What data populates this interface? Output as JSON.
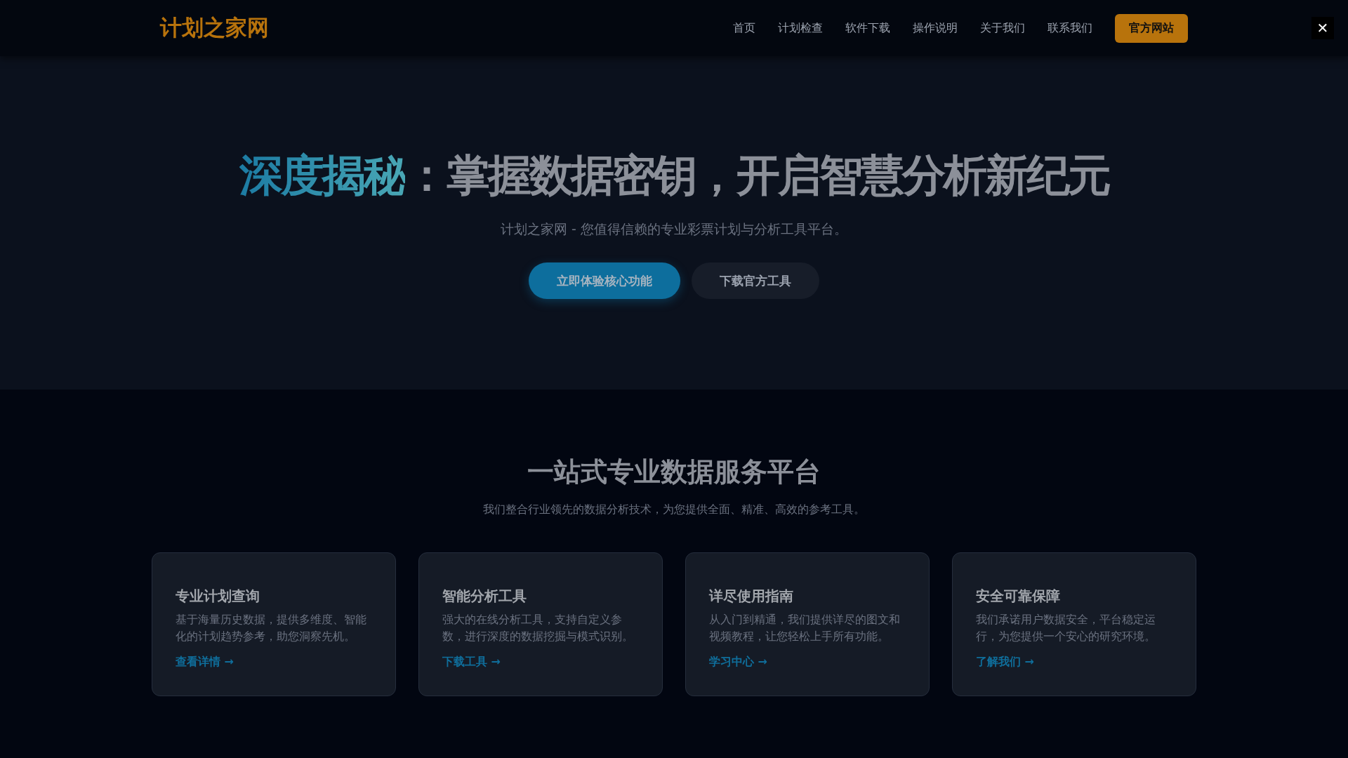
{
  "nav": {
    "logo": "计划之家网",
    "links": [
      {
        "label": "首页"
      },
      {
        "label": "计划检查"
      },
      {
        "label": "软件下载"
      },
      {
        "label": "操作说明"
      },
      {
        "label": "关于我们"
      },
      {
        "label": "联系我们"
      }
    ],
    "cta": "官方网站",
    "close": "✕"
  },
  "hero": {
    "title_highlight": "深度揭秘",
    "title_rest": "：掌握数据密钥，开启智慧分析新纪元",
    "subtitle": "计划之家网 - 您值得信赖的专业彩票计划与分析工具平台。",
    "buttons": [
      {
        "label": "立即体验核心功能",
        "kind": "primary"
      },
      {
        "label": "下载官方工具",
        "kind": "secondary"
      }
    ]
  },
  "features": {
    "title": "一站式专业数据服务平台",
    "subtitle": "我们整合行业领先的数据分析技术，为您提供全面、精准、高效的参考工具。",
    "cards": [
      {
        "title": "专业计划查询",
        "text": "基于海量历史数据，提供多维度、智能化的计划趋势参考，助您洞察先机。",
        "link": "查看详情 →"
      },
      {
        "title": "智能分析工具",
        "text": "强大的在线分析工具，支持自定义参数，进行深度的数据挖掘与模式识别。",
        "link": "下载工具 →"
      },
      {
        "title": "详尽使用指南",
        "text": "从入门到精通，我们提供详尽的图文和视频教程，让您轻松上手所有功能。",
        "link": "学习中心 →"
      },
      {
        "title": "安全可靠保障",
        "text": "我们承诺用户数据安全，平台稳定运行，为您提供一个安心的研究环境。",
        "link": "了解我们 →"
      }
    ]
  }
}
